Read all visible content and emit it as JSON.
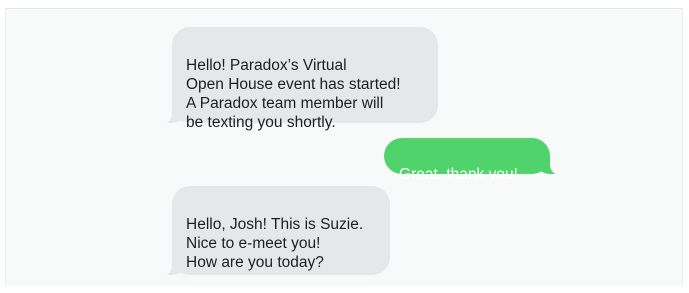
{
  "conversation": {
    "messages": [
      {
        "direction": "incoming",
        "text": "Hello! Paradox’s Virtual\nOpen House event has started!\nA Paradox team member will\nbe texting you shortly."
      },
      {
        "direction": "outgoing",
        "text": "Great, thank you!"
      },
      {
        "direction": "incoming",
        "text": "Hello, Josh! This is Suzie.\nNice to e-meet you!\nHow are you today?"
      }
    ]
  },
  "colors": {
    "incoming_bubble": "#e6e7eb",
    "outgoing_bubble": "#4fd36a",
    "background": "#f8f9f9"
  }
}
